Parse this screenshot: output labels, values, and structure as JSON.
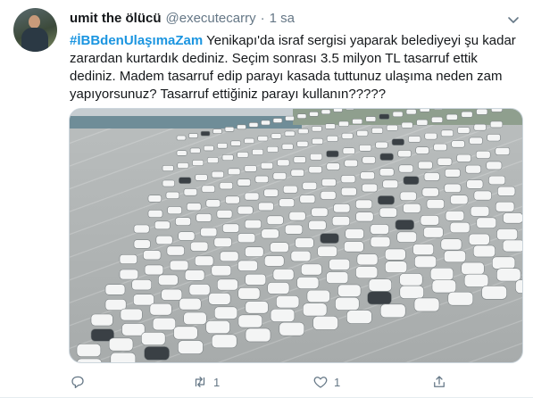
{
  "tweet": {
    "author_name": "umit the ölücü",
    "handle": "@executecarry",
    "separator": "·",
    "time": "1 sa",
    "hashtag": "#İBBdenUlaşımaZam",
    "body": " Yenikapı'da israf sergisi yaparak belediyeyi şu kadar zarardan kurtardık dediniz. Seçim sonrası 3.5 milyon TL tasarruf ettik dediniz. Madem tasarruf edip parayı kasada tuttunuz ulaşıma neden zam yapıyorsunuz? Tasarruf ettiğiniz parayı kullanın?????",
    "media_alt": "Aerial photo of many white cars parked in rows on a large lot",
    "actions": {
      "reply_count": "",
      "retweet_count": "1",
      "like_count": "1",
      "share_count": ""
    }
  },
  "colors": {
    "link": "#1b95e0",
    "muted": "#657786",
    "text": "#14171a",
    "border": "#e6ecf0"
  },
  "icons": {
    "caret": "chevron-down-icon",
    "reply": "reply-icon",
    "retweet": "retweet-icon",
    "like": "heart-icon",
    "share": "share-icon"
  }
}
